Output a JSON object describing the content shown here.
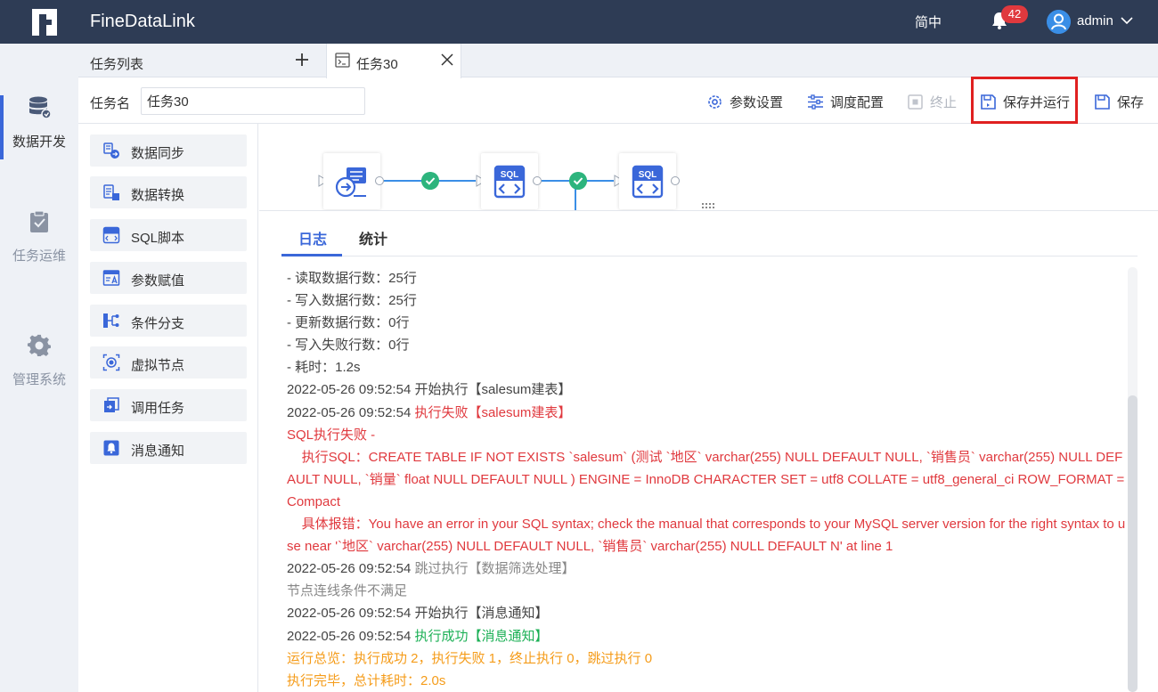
{
  "app": {
    "title": "FineDataLink"
  },
  "header": {
    "language": "简中",
    "notification_count": "42",
    "username": "admin"
  },
  "leftnav": {
    "items": [
      {
        "label": "数据开发",
        "icon": "database-icon",
        "active": true
      },
      {
        "label": "任务运维",
        "icon": "clipboard-check-icon",
        "active": false
      },
      {
        "label": "管理系统",
        "icon": "gear-icon",
        "active": false
      }
    ]
  },
  "tabs": {
    "list_label": "任务列表",
    "active_tab": "任务30"
  },
  "toolbar": {
    "taskname_label": "任务名",
    "taskname_value": "任务30",
    "param_settings": "参数设置",
    "schedule_config": "调度配置",
    "stop": "终止",
    "save_and_run": "保存并运行",
    "save": "保存"
  },
  "palette": {
    "items": [
      {
        "label": "数据同步",
        "icon": "data-sync-icon"
      },
      {
        "label": "数据转换",
        "icon": "data-transform-icon"
      },
      {
        "label": "SQL脚本",
        "icon": "sql-script-icon"
      },
      {
        "label": "参数赋值",
        "icon": "param-assign-icon"
      },
      {
        "label": "条件分支",
        "icon": "branch-icon"
      },
      {
        "label": "虚拟节点",
        "icon": "virtual-node-icon"
      },
      {
        "label": "调用任务",
        "icon": "call-task-icon"
      },
      {
        "label": "消息通知",
        "icon": "notification-icon"
      }
    ]
  },
  "canvas": {
    "node_sql_label": "SQL"
  },
  "log": {
    "tabs": [
      "日志",
      "统计"
    ],
    "lines": [
      {
        "text": "- 读取数据行数：25行"
      },
      {
        "text": "- 写入数据行数：25行"
      },
      {
        "text": "- 更新数据行数：0行"
      },
      {
        "text": "- 写入失败行数：0行"
      },
      {
        "text": "- 耗时：1.2s"
      },
      {
        "time": "2022-05-26 09:52:54",
        "msg": "开始执行【salesum建表】",
        "style": "normal"
      },
      {
        "time": "2022-05-26 09:52:54",
        "msg": "执行失败【salesum建表】",
        "style": "red"
      },
      {
        "text": "SQL执行失败 -",
        "style": "red"
      },
      {
        "text": "    执行SQL：CREATE TABLE IF NOT EXISTS `salesum` (测试 `地区` varchar(255) NULL DEFAULT NULL, `销售员` varchar(255) NULL DEFAULT NULL, `销量` float NULL DEFAULT NULL ) ENGINE = InnoDB CHARACTER SET = utf8 COLLATE = utf8_general_ci ROW_FORMAT = Compact",
        "style": "red"
      },
      {
        "text": "    具体报错：You have an error in your SQL syntax; check the manual that corresponds to your MySQL server version for the right syntax to use near '`地区` varchar(255) NULL DEFAULT NULL, `销售员` varchar(255) NULL DEFAULT N' at line 1",
        "style": "red"
      },
      {
        "time": "2022-05-26 09:52:54",
        "msg": "跳过执行【数据筛选处理】",
        "style": "gray"
      },
      {
        "text": "节点连线条件不满足",
        "style": "gray"
      },
      {
        "time": "2022-05-26 09:52:54",
        "msg": "开始执行【消息通知】",
        "style": "normal"
      },
      {
        "time": "2022-05-26 09:52:54",
        "msg": "执行成功【消息通知】",
        "style": "green"
      },
      {
        "text": "运行总览：执行成功 2，执行失败 1，终止执行 0，跳过执行 0",
        "style": "orange"
      },
      {
        "text": "执行完毕，总计耗时：2.0s",
        "style": "orange"
      }
    ]
  },
  "colors": {
    "header_bg": "#2e3c55",
    "accent": "#3a67d9",
    "error": "#e0393e",
    "success": "#1cb056",
    "warning": "#f59c1a",
    "highlight": "#e02020"
  }
}
